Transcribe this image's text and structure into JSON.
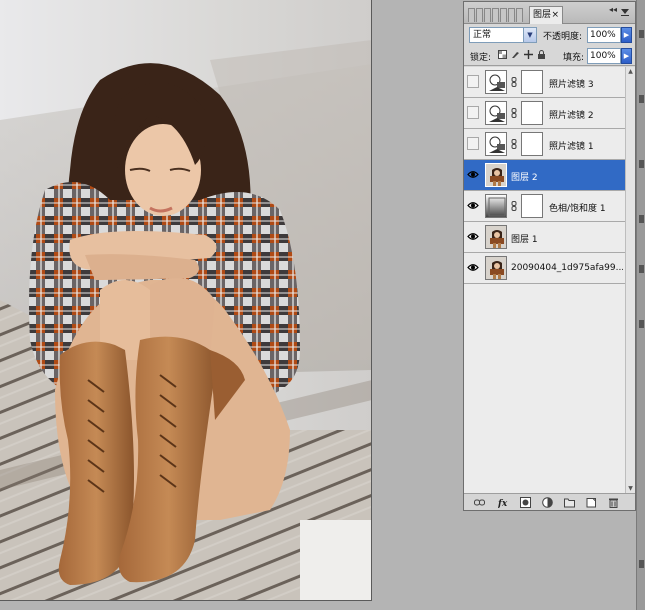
{
  "panel": {
    "tab_label": "图层",
    "tab_close": "×",
    "menu_icon": "panel-menu-icon",
    "collapse_label": "◂◂"
  },
  "controls": {
    "blend_mode": "正常",
    "opacity_label": "不透明度:",
    "opacity_value": "100%",
    "lock_label": "锁定:",
    "fill_label": "填充:",
    "fill_value": "100%"
  },
  "layers": [
    {
      "name": "照片滤镜 3",
      "visible": false,
      "type": "adjustment",
      "selected": false
    },
    {
      "name": "照片滤镜 2",
      "visible": false,
      "type": "adjustment",
      "selected": false
    },
    {
      "name": "照片滤镜 1",
      "visible": false,
      "type": "adjustment",
      "selected": false
    },
    {
      "name": "图层 2",
      "visible": true,
      "type": "photo",
      "selected": true
    },
    {
      "name": "色相/饱和度 1",
      "visible": true,
      "type": "gradient",
      "selected": false
    },
    {
      "name": "图层 1",
      "visible": true,
      "type": "photo",
      "selected": false
    },
    {
      "name": "20090404_1d975afa99...",
      "visible": true,
      "type": "photo",
      "selected": false
    }
  ],
  "bottom_icons": [
    "link-layers-icon",
    "fx-icon",
    "add-mask-icon",
    "adjustment-layer-icon",
    "new-group-icon",
    "new-layer-icon",
    "trash-icon"
  ],
  "colors": {
    "selection": "#316ac5",
    "panel_bg": "#d7d7d7",
    "workspace": "#b4b4b4"
  }
}
